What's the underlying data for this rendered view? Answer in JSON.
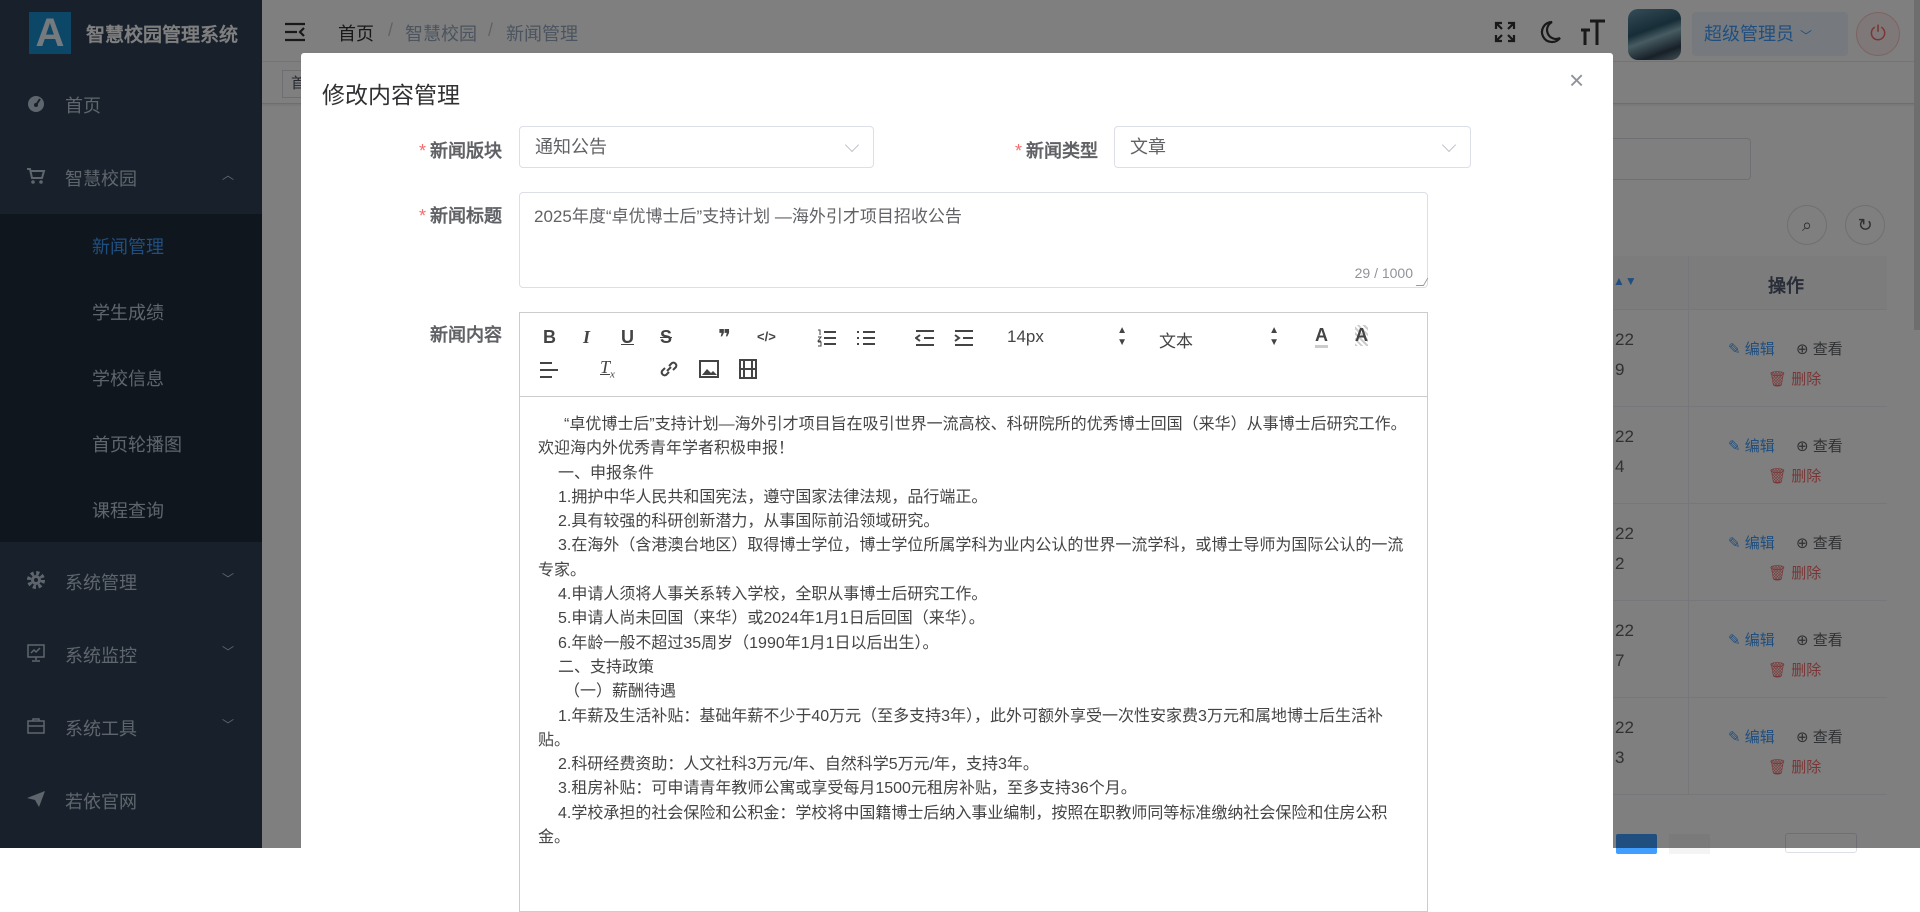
{
  "app": {
    "logo_letter": "A",
    "title": "智慧校园管理系统"
  },
  "sidebar": {
    "home": "首页",
    "campus": {
      "label": "智慧校园",
      "children": [
        "新闻管理",
        "学生成绩",
        "学校信息",
        "首页轮播图",
        "课程查询"
      ]
    },
    "system": "系统管理",
    "monitor": "系统监控",
    "tools": "系统工具",
    "official": "若依官网"
  },
  "header": {
    "breadcrumb": [
      "首页",
      "智慧校园",
      "新闻管理"
    ],
    "separator": "/",
    "user": "超级管理员",
    "tag_partial": "首"
  },
  "table": {
    "action_header": "操作",
    "rows": [
      {
        "date_tail": "22",
        "time_tail": "9"
      },
      {
        "date_tail": "22",
        "time_tail": "4"
      },
      {
        "date_tail": "22",
        "time_tail": "2"
      },
      {
        "date_tail": "22",
        "time_tail": "7"
      },
      {
        "date_tail": "22",
        "time_tail": "3"
      }
    ],
    "edit": "编辑",
    "view": "查看",
    "delete": "删除"
  },
  "modal": {
    "title": "修改内容管理",
    "section_label": "新闻版块",
    "section_value": "通知公告",
    "type_label": "新闻类型",
    "type_value": "文章",
    "title_label": "新闻标题",
    "title_value": "2025年度“卓优博士后”支持计划 —海外引才项目招收公告",
    "title_count": "29 / 1000",
    "content_label": "新闻内容",
    "required_mark": "*",
    "toolbar": {
      "bold": "B",
      "italic": "I",
      "underline": "U",
      "strike": "S",
      "quote": "❞",
      "code": "</>",
      "size": "14px",
      "header": "文本"
    },
    "paragraphs": [
      "“卓优博士后”支持计划—海外引才项目旨在吸引世界一流高校、科研院所的优秀博士回国（来华）从事博士后研究工作。欢迎海内外优秀青年学者积极申报！",
      "一、申报条件",
      "1.拥护中华人民共和国宪法，遵守国家法律法规，品行端正。",
      "2.具有较强的科研创新潜力，从事国际前沿领域研究。",
      "3.在海外（含港澳台地区）取得博士学位，博士学位所属学科为业内公认的世界一流学科，或博士导师为国际公认的一流专家。",
      "4.申请人须将人事关系转入学校，全职从事博士后研究工作。",
      "5.申请人尚未回国（来华）或2024年1月1日后回国（来华）。",
      "6.年龄一般不超过35周岁（1990年1月1日以后出生）。",
      "二、支持政策",
      "（一）薪酬待遇",
      "1.年薪及生活补贴：基础年薪不少于40万元（至多支持3年），此外可额外享受一次性安家费3万元和属地博士后生活补贴。",
      "2.科研经费资助：人文社科3万元/年、自然科学5万元/年，支持3年。",
      "3.租房补贴：可申请青年教师公寓或享受每月1500元租房补贴，至多支持36个月。",
      "4.学校承担的社会保险和公积金：学校将中国籍博士后纳入事业编制，按照在职教师同等标准缴纳社会保险和住房公积金。"
    ]
  },
  "colors": {
    "primary": "#409eff",
    "danger": "#f56c6c",
    "sidebar": "#304156"
  }
}
